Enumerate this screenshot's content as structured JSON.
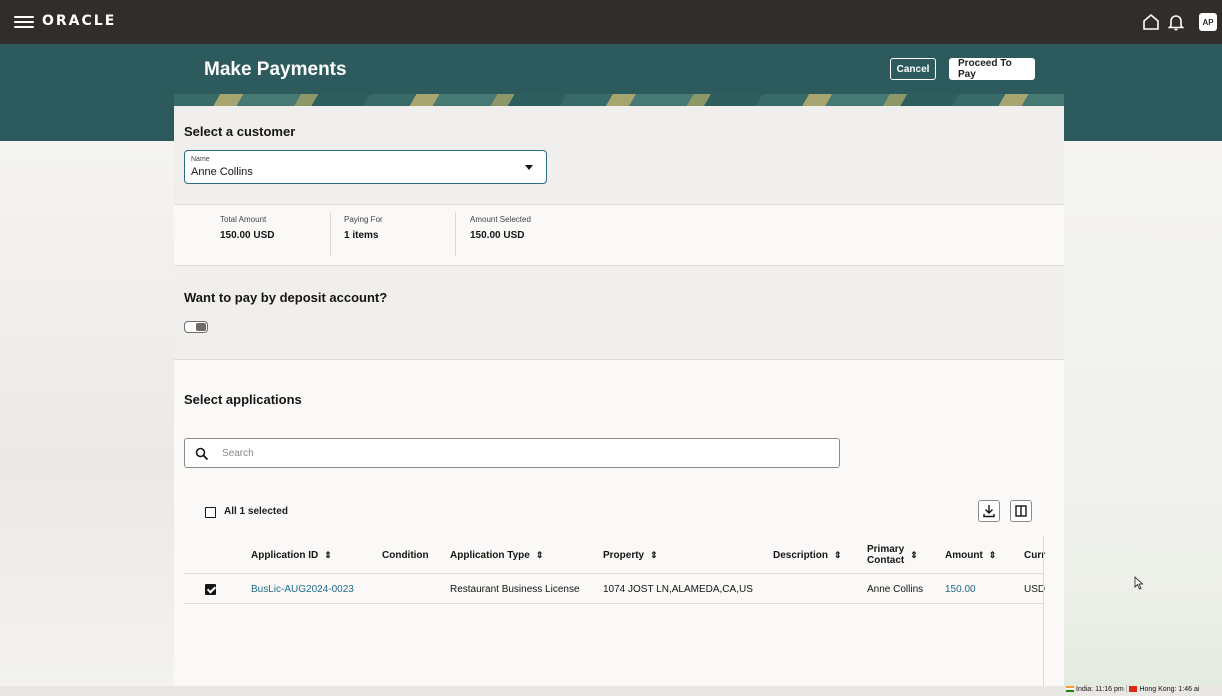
{
  "topbar": {
    "logo": "ORACLE",
    "avatar_initials": "AP",
    "icons": [
      "menu-icon",
      "home-icon",
      "bell-icon"
    ]
  },
  "header": {
    "title": "Make Payments",
    "cancel_label": "Cancel",
    "proceed_label": "Proceed To Pay"
  },
  "customer": {
    "section_title": "Select a customer",
    "name_label": "Name",
    "name_value": "Anne Collins"
  },
  "summary": {
    "total_label": "Total Amount",
    "total_value": "150.00 USD",
    "paying_label": "Paying For",
    "paying_value": "1 items",
    "selected_label": "Amount Selected",
    "selected_value": "150.00 USD"
  },
  "deposit": {
    "section_title": "Want to pay by deposit account?",
    "toggle_on": false
  },
  "applications": {
    "section_title": "Select applications",
    "search_placeholder": "Search",
    "all_selected_label": "All 1 selected",
    "columns": {
      "application_id": "Application ID",
      "condition": "Condition",
      "application_type": "Application Type",
      "property": "Property",
      "description": "Description",
      "primary_contact_1": "Primary",
      "primary_contact_2": "Contact",
      "amount": "Amount",
      "currency": "Curr"
    },
    "rows": [
      {
        "checked": true,
        "application_id": "BusLic-AUG2024-0023",
        "condition": "",
        "application_type": "Restaurant Business License",
        "property": "1074 JOST LN,ALAMEDA,CA,US",
        "description": "",
        "primary_contact": "Anne Collins",
        "amount": "150.00",
        "currency": "USD"
      }
    ]
  },
  "statusbar": {
    "india": "India: 11:16 pm",
    "hongkong": "Hong Kong: 1:46 ai"
  },
  "colors": {
    "topbar": "#312d2a",
    "band": "#2c5a5d",
    "link": "#1e6a8a"
  }
}
